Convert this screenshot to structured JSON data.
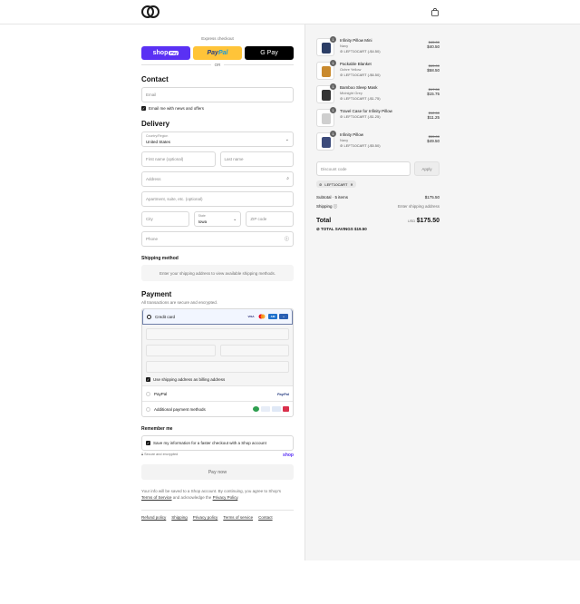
{
  "header": {
    "logo_icon": "loop-logo-icon",
    "cart_icon": "bag-icon"
  },
  "express": {
    "label": "Express checkout",
    "shoppay": {
      "text": "shop",
      "suffix": "Pay"
    },
    "paypal": {
      "pay": "Pay",
      "pal": "Pal"
    },
    "gpay": "G Pay",
    "or": "OR"
  },
  "contact": {
    "title": "Contact",
    "email_placeholder": "Email",
    "news_label": "Email me with news and offers"
  },
  "delivery": {
    "title": "Delivery",
    "country_label": "Country/Region",
    "country_value": "United States",
    "first_name": "First name (optional)",
    "last_name": "Last name",
    "address": "Address",
    "apartment": "Apartment, suite, etc. (optional)",
    "city": "City",
    "state_label": "State",
    "state_value": "Iowa",
    "zip": "ZIP code",
    "phone": "Phone"
  },
  "shipping": {
    "title": "Shipping method",
    "info": "Enter your shipping address to view available shipping methods."
  },
  "payment": {
    "title": "Payment",
    "subtitle": "All transactions are secure and encrypted.",
    "credit_card": "Credit card",
    "billing_label": "Use shipping address as billing address",
    "paypal": "PayPal",
    "paypal_logo": "PayPal",
    "additional": "Additional payment methods"
  },
  "remember": {
    "title": "Remember me",
    "save_label": "Save my information for a faster checkout with a Shop account",
    "secure": "Secure and encrypted",
    "shop_logo": "shop"
  },
  "pay_now": "Pay now",
  "legal": {
    "text1": "Your info will be saved to a Shop account. By continuing, you agree to Shop's",
    "terms": "Terms of Service",
    "and": "and acknowledge the",
    "privacy": "Privacy Policy",
    "end": "."
  },
  "footer": {
    "links": [
      "Refund policy",
      "Shipping",
      "Privacy policy",
      "Terms of service",
      "Contact"
    ]
  },
  "cart": {
    "items": [
      {
        "name": "Infinity Pillow Mini",
        "variant": "Navy",
        "discount": "LEFT10CART (-$4.50)",
        "old_price": "$45.00",
        "price": "$40.50",
        "qty": "1",
        "color": "#2c3e66"
      },
      {
        "name": "Packable Blanket",
        "variant": "Ochre Yellow",
        "discount": "LEFT10CART (-$6.50)",
        "old_price": "$65.00",
        "price": "$58.50",
        "qty": "1",
        "color": "#c98a2e"
      },
      {
        "name": "Bamboo Sleep Mask",
        "variant": "Midnight Grey",
        "discount": "LEFT10CART (-$1.75)",
        "old_price": "$17.50",
        "price": "$15.75",
        "qty": "1",
        "color": "#333333"
      },
      {
        "name": "Travel Case for Infinity Pillow",
        "variant": "",
        "discount": "LEFT10CART (-$1.25)",
        "old_price": "$12.50",
        "price": "$11.25",
        "qty": "1",
        "color": "#cfcfcf"
      },
      {
        "name": "Infinity Pillow",
        "variant": "Navy",
        "discount": "LEFT10CART (-$5.50)",
        "old_price": "$55.00",
        "price": "$49.50",
        "qty": "1",
        "color": "#3b4a7a"
      }
    ],
    "discount_placeholder": "Discount code",
    "apply": "Apply",
    "applied_code": "LEFT10CART",
    "subtotal_label": "Subtotal · 5 items",
    "subtotal": "$175.50",
    "shipping_label": "Shipping",
    "shipping_value": "Enter shipping address",
    "total_label": "Total",
    "currency": "USD",
    "total": "$175.50",
    "savings_label": "TOTAL SAVINGS",
    "savings": "$19.50"
  },
  "colors": {
    "shoppay": "#5a31f4",
    "paypal": "#ffc439",
    "panel": "#f5f5f5"
  }
}
